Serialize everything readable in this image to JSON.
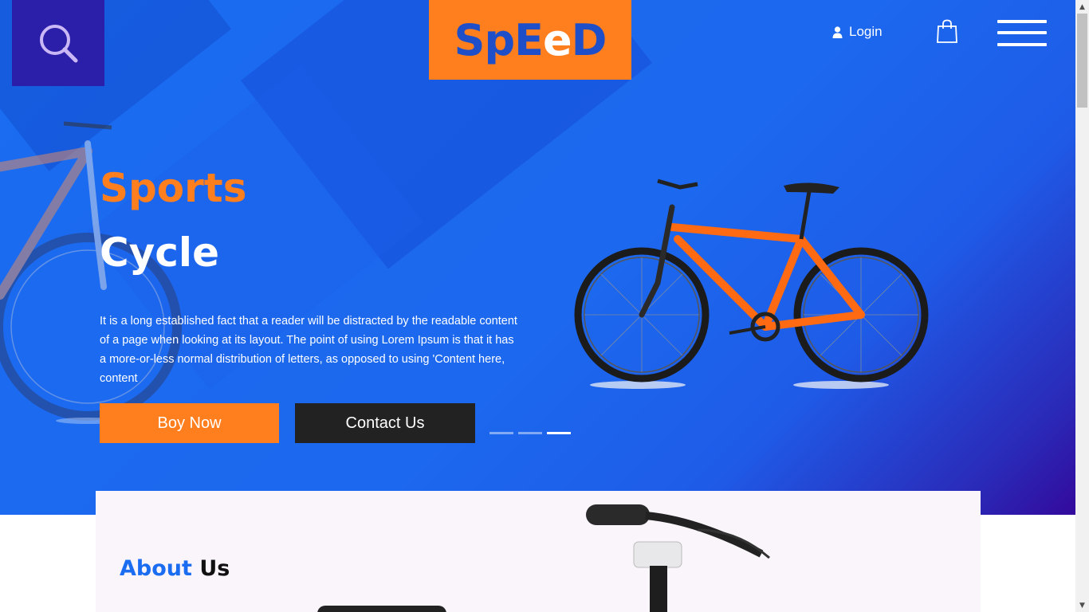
{
  "header": {
    "logo_part1": "SpE",
    "logo_part2": "e",
    "logo_part3": "D",
    "login_label": "Login"
  },
  "hero": {
    "title_line1": "Sports",
    "title_line2": "Cycle",
    "description": "It is a long established fact that a reader will be distracted by the readable content of a page when looking at its layout. The point of using Lorem Ipsum is that it has a more-or-less normal distribution of letters, as opposed to using 'Content here, content",
    "buy_button": "Boy Now",
    "contact_button": "Contact Us",
    "slides": 3,
    "active_slide": 3
  },
  "about": {
    "title_part1": "About",
    "title_part2": "Us"
  },
  "colors": {
    "accent_orange": "#ff7f1f",
    "hero_blue": "#1a6cf0",
    "search_box": "#2b1ea8",
    "dark_button": "#222222"
  },
  "icons": [
    "search-icon",
    "user-icon",
    "shopping-bag-icon",
    "hamburger-menu-icon"
  ]
}
